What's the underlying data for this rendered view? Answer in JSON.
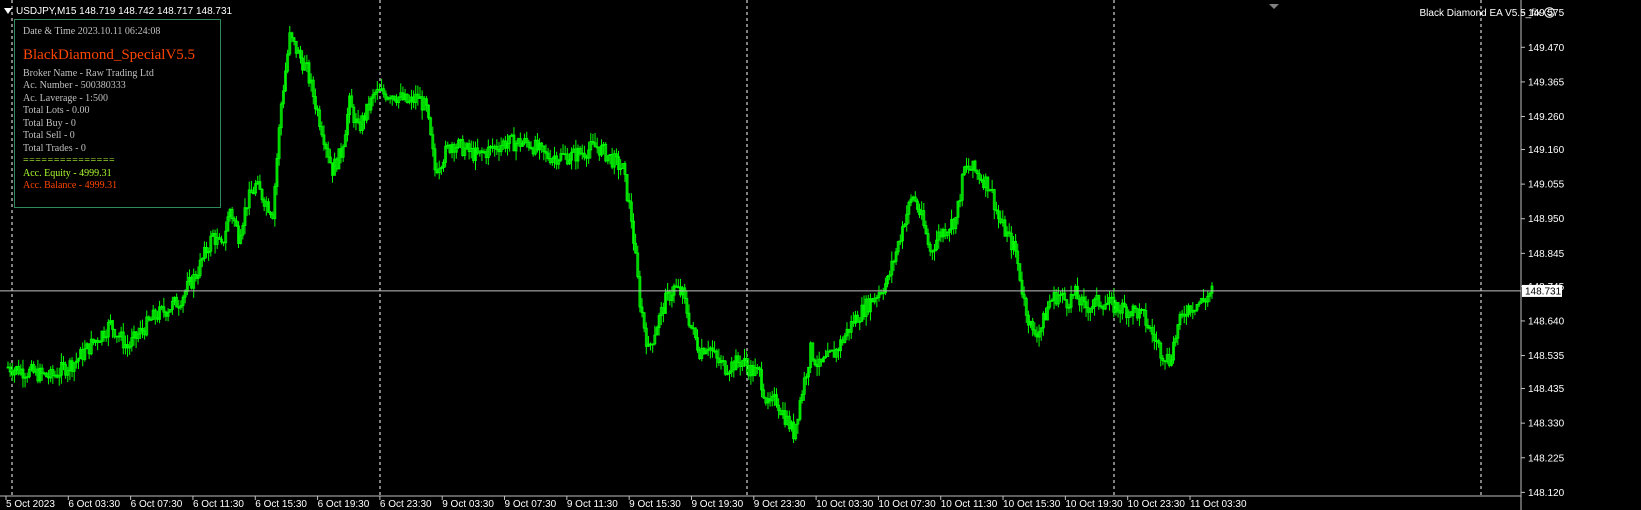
{
  "header": {
    "symbol_info": "USDJPY,M15  148.719 148.742 148.717 148.731",
    "ea_label": "Black Diamond EA  V5.5_fix"
  },
  "panel": {
    "datetime": "Date & Time 2023.10.11 06:24:08",
    "title": "BlackDiamond_SpecialV5.5",
    "broker": "Broker Name - Raw Trading Ltd",
    "account": "Ac. Number - 500380333",
    "leverage": "Ac. Laverage - 1:500",
    "total_lots": "Total Lots - 0.00",
    "total_buy": "Total Buy - 0",
    "total_sell": "Total Sell - 0",
    "total_trades": "Total Trades - 0",
    "separator": "===============",
    "equity": "Acc. Equity - 4999.31",
    "balance": "Acc. Balance - 4999.31"
  },
  "colors": {
    "background": "#000000",
    "candle": "#00ff00",
    "grid": "#ffffff",
    "price_line": "#c0c0c0",
    "panel_border": "#2e8b57",
    "panel_title": "#ff4500",
    "equity": "#adff2f",
    "balance": "#ff4500"
  },
  "icons": {
    "ea_status": "smiley-icon",
    "menu": "triangle-down-icon"
  },
  "chart_data": {
    "type": "candlestick",
    "symbol": "USDJPY",
    "timeframe": "M15",
    "ylim": [
      148.12,
      149.6
    ],
    "y_ticks": [
      "149.575",
      "149.470",
      "149.365",
      "149.260",
      "149.160",
      "149.055",
      "148.950",
      "148.845",
      "148.745",
      "148.640",
      "148.535",
      "148.435",
      "148.330",
      "148.225",
      "148.120"
    ],
    "current_price": "148.731",
    "current_price_value": 148.731,
    "x_ticks": [
      "5 Oct 2023",
      "6 Oct 03:30",
      "6 Oct 07:30",
      "6 Oct 11:30",
      "6 Oct 15:30",
      "6 Oct 19:30",
      "6 Oct 23:30",
      "9 Oct 03:30",
      "9 Oct 07:30",
      "9 Oct 11:30",
      "9 Oct 15:30",
      "9 Oct 19:30",
      "9 Oct 23:30",
      "10 Oct 03:30",
      "10 Oct 07:30",
      "10 Oct 11:30",
      "10 Oct 15:30",
      "10 Oct 19:30",
      "10 Oct 23:30",
      "11 Oct 03:30"
    ],
    "session_separators_after_tick": [
      6,
      12,
      18
    ],
    "close_path": [
      [
        0,
        148.5
      ],
      [
        5,
        148.47
      ],
      [
        8,
        148.52
      ],
      [
        12,
        148.63
      ],
      [
        14,
        148.56
      ],
      [
        17,
        148.65
      ],
      [
        20,
        148.7
      ],
      [
        22,
        148.78
      ],
      [
        24,
        148.9
      ],
      [
        25,
        148.86
      ],
      [
        26,
        148.98
      ],
      [
        27,
        148.9
      ],
      [
        28,
        149.0
      ],
      [
        29,
        149.05
      ],
      [
        31,
        148.97
      ],
      [
        32,
        149.3
      ],
      [
        33,
        149.5
      ],
      [
        35,
        149.4
      ],
      [
        36,
        149.3
      ],
      [
        37,
        149.2
      ],
      [
        38,
        149.1
      ],
      [
        39,
        149.15
      ],
      [
        40,
        149.3
      ],
      [
        41,
        149.22
      ],
      [
        43,
        149.33
      ],
      [
        45,
        149.33
      ],
      [
        47,
        149.3
      ],
      [
        48,
        149.32
      ],
      [
        49,
        149.28
      ],
      [
        50,
        149.1
      ],
      [
        52,
        149.18
      ],
      [
        55,
        149.14
      ],
      [
        58,
        149.18
      ],
      [
        61,
        149.18
      ],
      [
        63,
        149.14
      ],
      [
        66,
        149.14
      ],
      [
        69,
        149.17
      ],
      [
        72,
        149.1
      ],
      [
        73,
        148.95
      ],
      [
        74,
        148.7
      ],
      [
        75,
        148.55
      ],
      [
        76,
        148.63
      ],
      [
        77,
        148.7
      ],
      [
        78,
        148.74
      ],
      [
        79,
        148.72
      ],
      [
        80,
        148.62
      ],
      [
        81,
        148.55
      ],
      [
        82,
        148.57
      ],
      [
        83,
        148.52
      ],
      [
        84,
        148.5
      ],
      [
        86,
        148.52
      ],
      [
        87,
        148.49
      ],
      [
        88,
        148.48
      ],
      [
        89,
        148.38
      ],
      [
        90,
        148.4
      ],
      [
        92,
        148.3
      ],
      [
        93,
        148.43
      ],
      [
        94,
        148.55
      ],
      [
        95,
        148.5
      ],
      [
        97,
        148.55
      ],
      [
        99,
        148.64
      ],
      [
        101,
        148.7
      ],
      [
        103,
        148.76
      ],
      [
        104,
        148.85
      ],
      [
        105,
        148.95
      ],
      [
        106,
        149.02
      ],
      [
        107,
        148.95
      ],
      [
        108,
        148.85
      ],
      [
        109,
        148.9
      ],
      [
        111,
        148.95
      ],
      [
        112,
        149.1
      ],
      [
        113,
        149.1
      ],
      [
        115,
        149.05
      ],
      [
        116,
        148.95
      ],
      [
        117,
        148.9
      ],
      [
        118,
        148.85
      ],
      [
        119,
        148.7
      ],
      [
        120,
        148.6
      ],
      [
        121,
        148.62
      ],
      [
        122,
        148.7
      ],
      [
        123,
        148.72
      ],
      [
        124,
        148.7
      ],
      [
        125,
        148.72
      ],
      [
        126,
        148.68
      ],
      [
        128,
        148.7
      ],
      [
        130,
        148.68
      ],
      [
        132,
        148.67
      ],
      [
        133,
        148.65
      ],
      [
        135,
        148.55
      ],
      [
        136,
        148.52
      ],
      [
        137,
        148.62
      ],
      [
        138,
        148.68
      ],
      [
        140,
        148.7
      ],
      [
        141,
        148.73
      ]
    ],
    "last_index": 141,
    "slots": 160
  }
}
